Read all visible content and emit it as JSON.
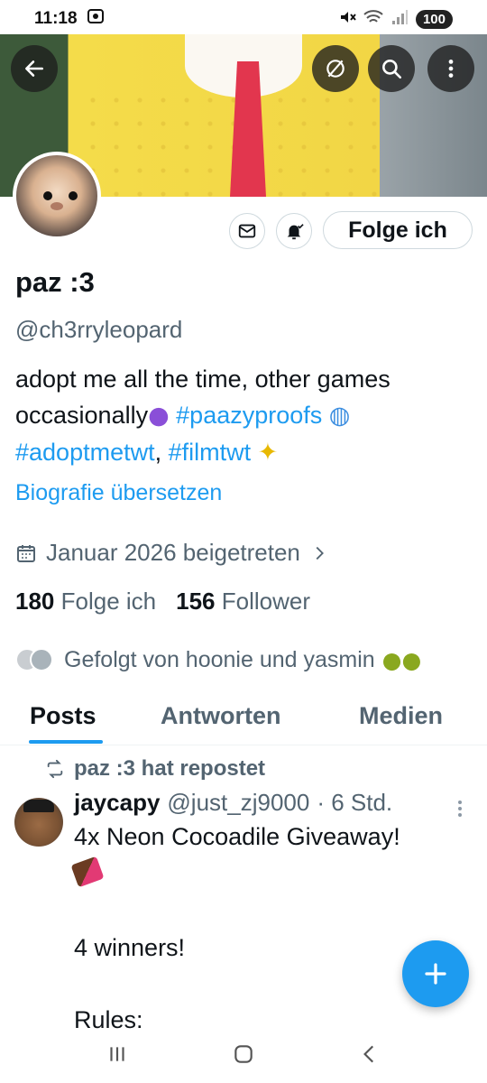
{
  "status_bar": {
    "time": "11:18",
    "battery": "100"
  },
  "profile": {
    "display_name": "paz :3",
    "handle": "@ch3rryleopard",
    "bio": {
      "line1": "adopt me all the time, other games",
      "line2_text": "occasionally",
      "line2_tag": "#paazyproofs",
      "line3_tag1": "#adoptmetwt",
      "line3_sep": ", ",
      "line3_tag2": "#filmtwt"
    },
    "translate_link": "Biografie übersetzen",
    "joined": "Januar 2026 beigetreten",
    "following_count": "180",
    "following_label": "Folge ich",
    "followers_count": "156",
    "followers_label": "Follower",
    "followed_by": "Gefolgt von hoonie und yasmin",
    "follow_button_label": "Folge ich"
  },
  "tabs": [
    "Posts",
    "Antworten",
    "Medien"
  ],
  "active_tab": "Posts",
  "post": {
    "repost_label": "paz :3 hat repostet",
    "author_name": "jaycapy",
    "author_handle": "@just_zj9000",
    "time": "· 6 Std.",
    "body_line1": "4x Neon Cocoadile Giveaway!",
    "body_rest": "4 winners!\n\nRules:"
  },
  "icons": {
    "back": "arrow-left-icon",
    "no_notify": "slash-circle-icon",
    "search": "search-icon",
    "more": "more-vertical-icon",
    "message": "envelope-icon",
    "notify": "bell-check-icon",
    "calendar": "calendar-icon",
    "repost": "repost-icon",
    "compose": "plus-icon"
  },
  "colors": {
    "accent": "#1d9bf0",
    "secondary_text": "#536471",
    "primary_text": "#0f1419"
  }
}
